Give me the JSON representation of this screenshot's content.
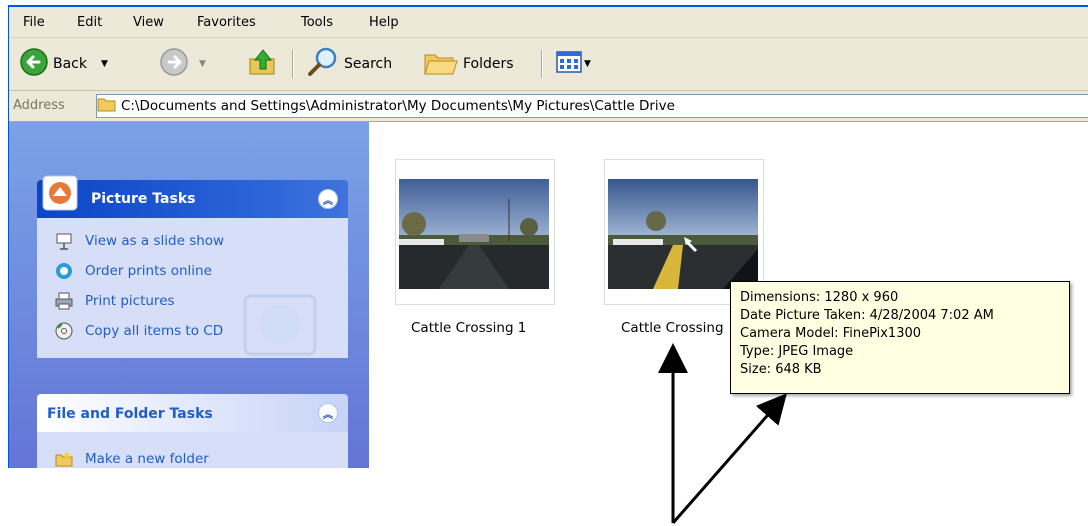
{
  "menubar": {
    "items": [
      "File",
      "Edit",
      "View",
      "Favorites",
      "Tools",
      "Help"
    ]
  },
  "toolbar": {
    "back_label": "Back",
    "search_label": "Search",
    "folders_label": "Folders"
  },
  "address": {
    "label": "Address",
    "path": "C:\\Documents and Settings\\Administrator\\My Documents\\My Pictures\\Cattle Drive"
  },
  "task_pane": {
    "picture_tasks": {
      "title": "Picture Tasks",
      "items": [
        "View as a slide show",
        "Order prints online",
        "Print pictures",
        "Copy all items to CD"
      ]
    },
    "file_folder_tasks": {
      "title": "File and Folder Tasks",
      "items": [
        "Make a new folder"
      ]
    }
  },
  "files": [
    {
      "name": "Cattle Crossing 1"
    },
    {
      "name": "Cattle Crossing"
    }
  ],
  "tooltip": {
    "dimensions": "Dimensions: 1280 x 960",
    "date_taken": "Date Picture Taken: 4/28/2004 7:02 AM",
    "camera_model": "Camera Model: FinePix1300",
    "type": "Type: JPEG Image",
    "size": "Size: 648 KB"
  },
  "colors": {
    "task_pane_bg": "#6f8fe0",
    "panel_header_special": "#2f5fd0",
    "link_text": "#215dc6",
    "tooltip_bg": "#ffffe1"
  }
}
